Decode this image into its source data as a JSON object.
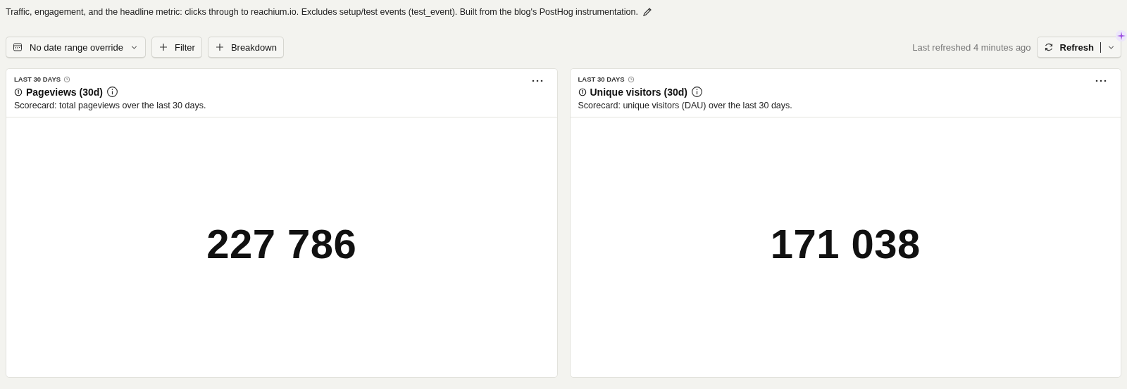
{
  "description": "Traffic, engagement, and the headline metric: clicks through to reachium.io. Excludes setup/test events (test_event). Built from the blog's PostHog instrumentation.",
  "toolbar": {
    "date_range": "No date range override",
    "filter": "Filter",
    "breakdown": "Breakdown",
    "last_refreshed": "Last refreshed 4 minutes ago",
    "refresh": "Refresh"
  },
  "cards": [
    {
      "date_label": "LAST 30 DAYS",
      "title": "Pageviews (30d)",
      "subtitle": "Scorecard: total pageviews over the last 30 days.",
      "value": "227 786"
    },
    {
      "date_label": "LAST 30 DAYS",
      "title": "Unique visitors (30d)",
      "subtitle": "Scorecard: unique visitors (DAU) over the last 30 days.",
      "value": "171 038"
    }
  ]
}
